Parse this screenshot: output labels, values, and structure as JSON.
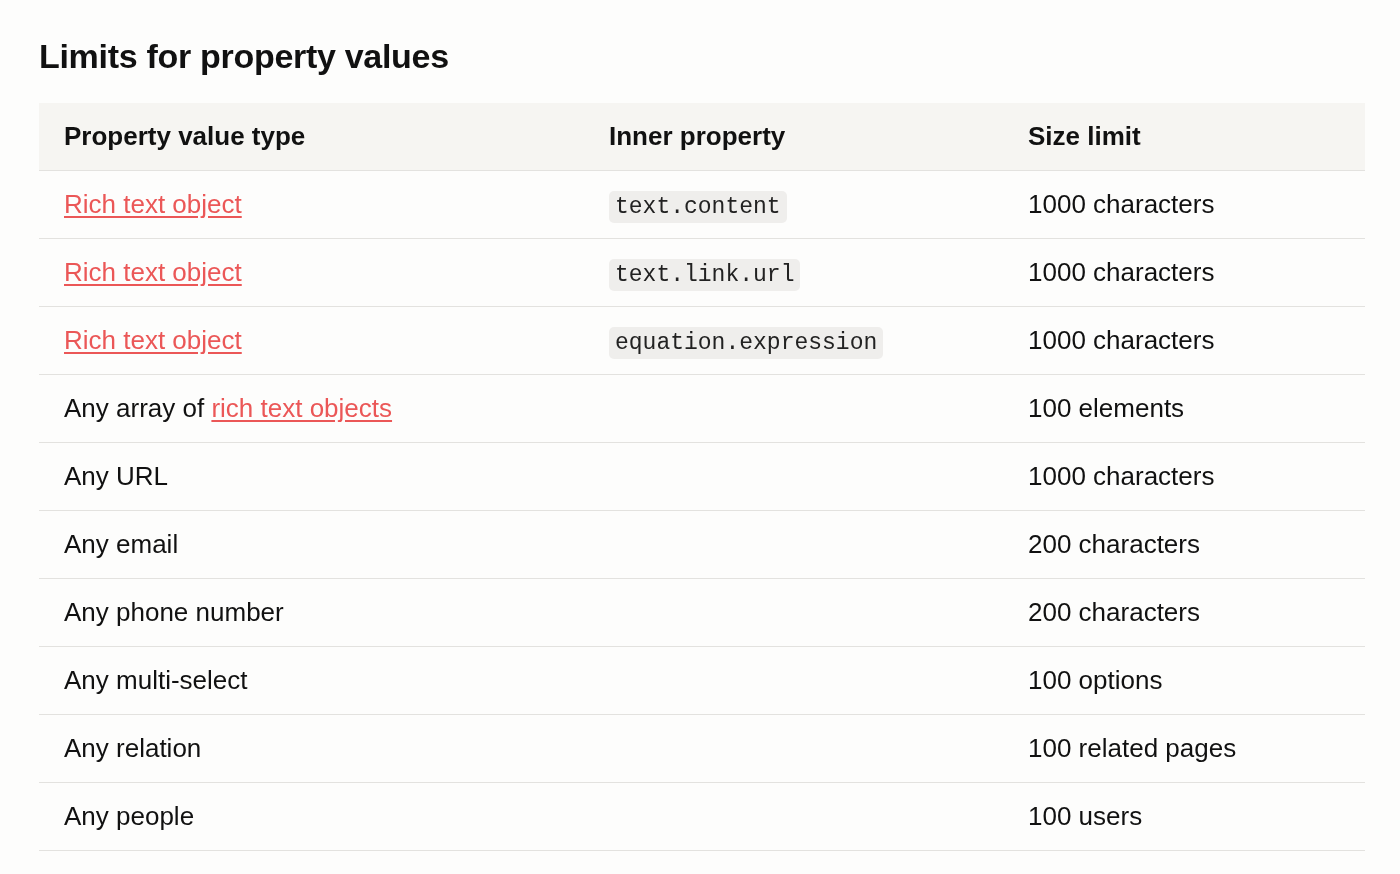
{
  "title": "Limits for property values",
  "table": {
    "columns": [
      "Property value type",
      "Inner property",
      "Size limit"
    ],
    "rows": [
      {
        "type": [
          {
            "kind": "link",
            "text": "Rich text object"
          }
        ],
        "inner_property": "text.content",
        "limit": "1000 characters"
      },
      {
        "type": [
          {
            "kind": "link",
            "text": "Rich text object"
          }
        ],
        "inner_property": "text.link.url",
        "limit": "1000 characters"
      },
      {
        "type": [
          {
            "kind": "link",
            "text": "Rich text object"
          }
        ],
        "inner_property": "equation.expression",
        "limit": "1000 characters"
      },
      {
        "type": [
          {
            "kind": "text",
            "text": "Any array of "
          },
          {
            "kind": "link",
            "text": "rich text objects"
          }
        ],
        "limit": "100 elements"
      },
      {
        "type": [
          {
            "kind": "text",
            "text": "Any URL"
          }
        ],
        "limit": "1000 characters"
      },
      {
        "type": [
          {
            "kind": "text",
            "text": "Any email"
          }
        ],
        "limit": "200 characters"
      },
      {
        "type": [
          {
            "kind": "text",
            "text": "Any phone number"
          }
        ],
        "limit": "200 characters"
      },
      {
        "type": [
          {
            "kind": "text",
            "text": "Any multi-select"
          }
        ],
        "limit": "100 options"
      },
      {
        "type": [
          {
            "kind": "text",
            "text": "Any relation"
          }
        ],
        "limit": "100 related pages"
      },
      {
        "type": [
          {
            "kind": "text",
            "text": "Any people"
          }
        ],
        "limit": "100 users"
      }
    ]
  }
}
